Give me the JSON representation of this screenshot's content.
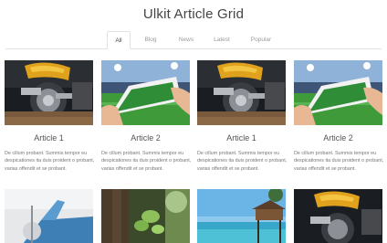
{
  "header": {
    "title": "Ulkit Article Grid"
  },
  "tabs": [
    {
      "label": "All",
      "active": true
    },
    {
      "label": "Blog",
      "active": false
    },
    {
      "label": "News",
      "active": false
    },
    {
      "label": "Latest",
      "active": false
    },
    {
      "label": "Popular",
      "active": false
    }
  ],
  "articles": [
    {
      "title": "Article 1",
      "excerpt": "De cillum probant. Summis tempor eu despicationes ita duis proident o probant, varias offendit et se probant.",
      "image": "motorcycle"
    },
    {
      "title": "Article 2",
      "excerpt": "De cillum probant. Summis tempor eu despicationes ita duis proident o probant, varias offendit et se probant.",
      "image": "phone-stadium"
    },
    {
      "title": "Article 1",
      "excerpt": "De cillum probant. Summis tempor eu despicationes ita duis proident o probant, varias offendit et se probant.",
      "image": "motorcycle"
    },
    {
      "title": "Article 2",
      "excerpt": "De cillum probant. Summis tempor eu despicationes ita duis proident o probant, varias offendit et se probant.",
      "image": "phone-stadium"
    }
  ],
  "row2_images": [
    "aircraft",
    "leaves",
    "beach-hut",
    "motorcycle"
  ]
}
